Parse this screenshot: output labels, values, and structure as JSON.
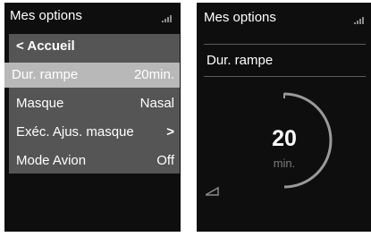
{
  "left_screen": {
    "title": "Mes options",
    "menu": {
      "back_label": "< Accueil",
      "items": [
        {
          "label": "Dur. rampe",
          "value": "20min."
        },
        {
          "label": "Masque",
          "value": "Nasal"
        },
        {
          "label": "Exéc. Ajus. masque",
          "value": ">"
        },
        {
          "label": "Mode Avion",
          "value": "Off"
        }
      ]
    }
  },
  "right_screen": {
    "title": "Mes options",
    "setting_name": "Dur. rampe",
    "dial": {
      "value": "20",
      "unit": "min.",
      "arc_fraction": 0.5
    },
    "icons": [
      "signal-icon",
      "ramp-icon"
    ]
  },
  "colors": {
    "screen_bg": "#0e0e0e",
    "menu_bg": "#555555",
    "selected_bg": "#b8b8b8",
    "arc": "#9a9a9a"
  }
}
